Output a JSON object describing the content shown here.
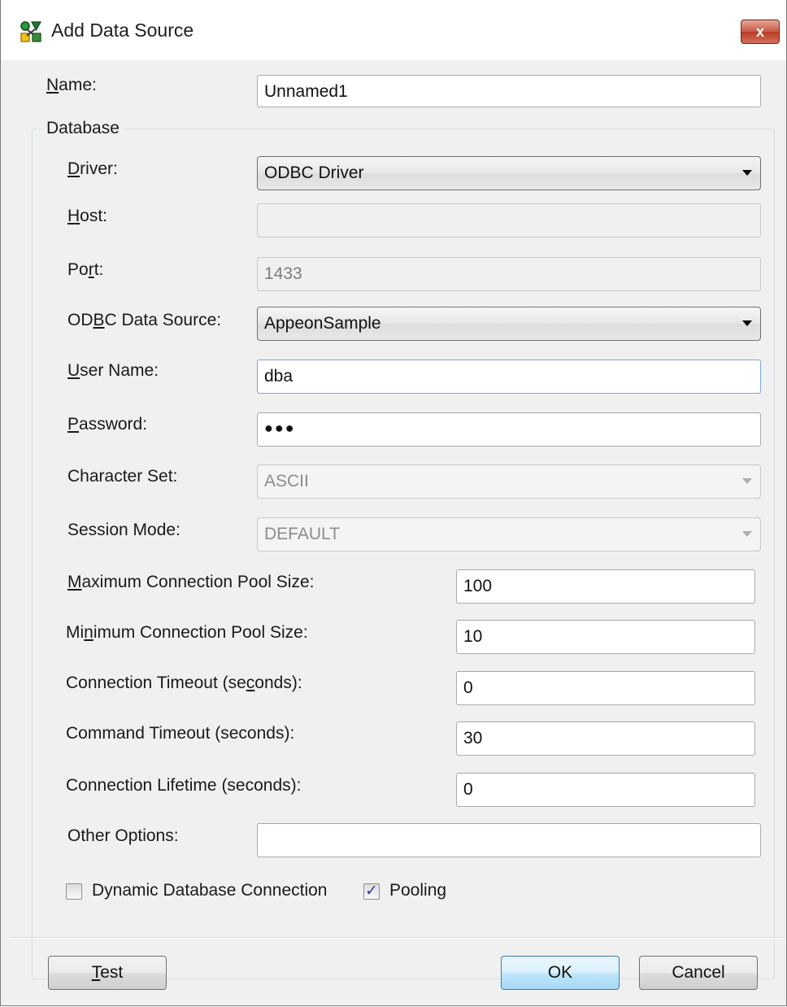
{
  "window": {
    "title": "Add Data Source",
    "close_label": "x"
  },
  "form": {
    "name_label_key": "N",
    "name_label_rest": "ame:",
    "name_value": "Unnamed1",
    "group_title": "Database",
    "driver_label_key": "D",
    "driver_label_rest": "river:",
    "driver_value": "ODBC Driver",
    "host_label_key": "H",
    "host_label_rest": "ost:",
    "host_value": "",
    "port_label_a": "Po",
    "port_label_key": "r",
    "port_label_b": "t:",
    "port_value": "1433",
    "odbc_label_a": "OD",
    "odbc_label_key": "B",
    "odbc_label_b": "C Data Source:",
    "odbc_value": "AppeonSample",
    "user_label_key": "U",
    "user_label_rest": "ser Name:",
    "user_value": "dba",
    "password_label_key": "P",
    "password_label_rest": "assword:",
    "password_value": "●●●",
    "charset_label": "Character Set:",
    "charset_value": "ASCII",
    "session_label": "Session Mode:",
    "session_value": "DEFAULT",
    "max_pool_label_key": "M",
    "max_pool_label_rest": "aximum Connection Pool Size:",
    "max_pool_value": "100",
    "min_pool_label_a": "Mi",
    "min_pool_label_key": "n",
    "min_pool_label_b": "imum Connection Pool Size:",
    "min_pool_value": "10",
    "conn_timeout_label_a": "Connection Timeout (se",
    "conn_timeout_label_key": "c",
    "conn_timeout_label_b": "onds):",
    "conn_timeout_value": "0",
    "cmd_timeout_label": "Command Timeout (seconds):",
    "cmd_timeout_value": "30",
    "lifetime_label": "Connection Lifetime (seconds):",
    "lifetime_value": "0",
    "other_label": "Other Options:",
    "other_value": "",
    "dynamic_label": "Dynamic Database Connection",
    "dynamic_checked": false,
    "pooling_label": "Pooling",
    "pooling_checked": true
  },
  "buttons": {
    "test_key": "T",
    "test_rest": "est",
    "ok": "OK",
    "cancel": "Cancel"
  }
}
